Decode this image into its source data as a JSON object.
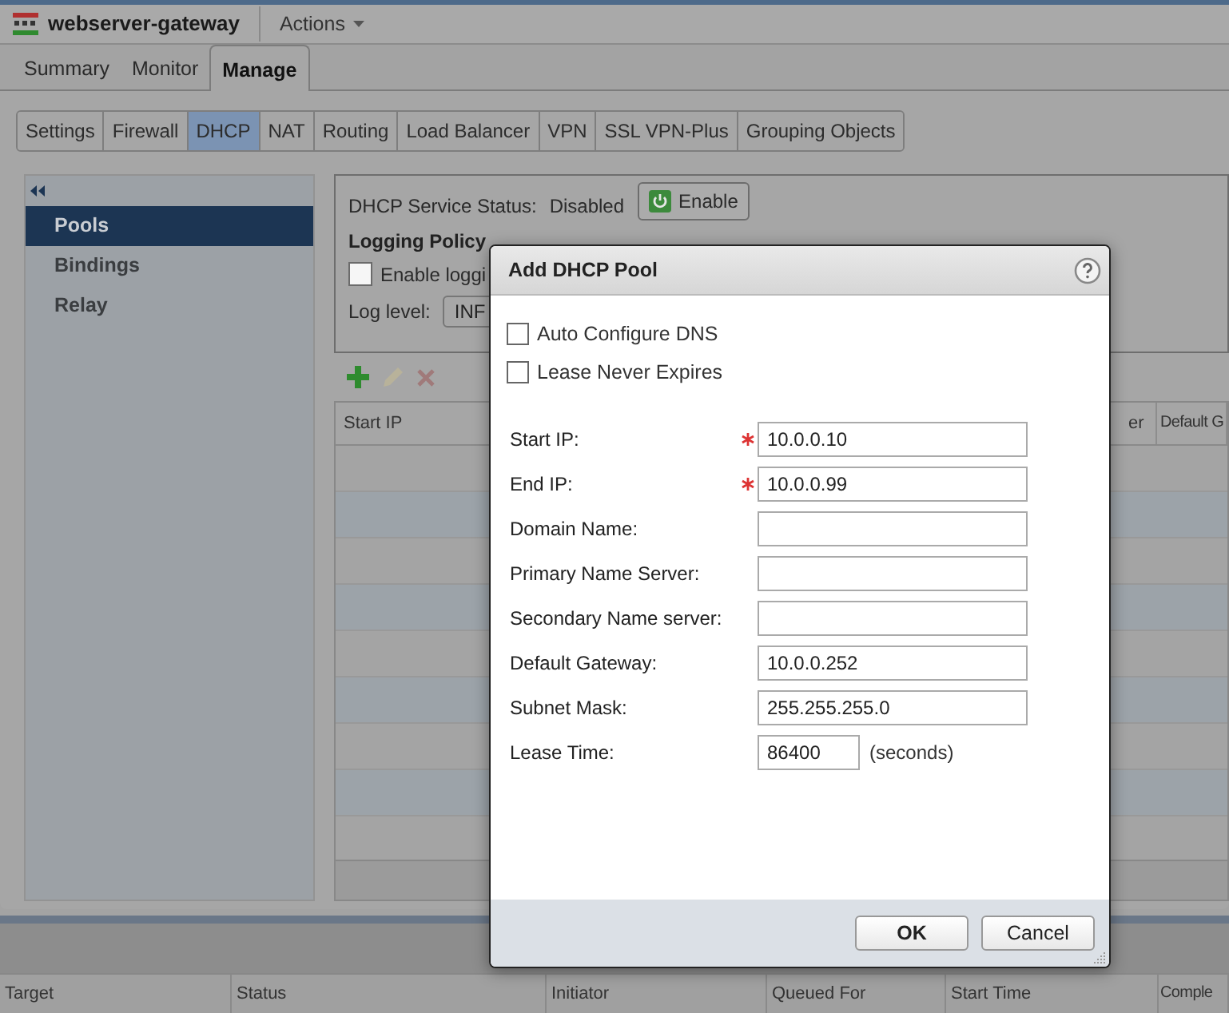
{
  "header": {
    "title": "webserver-gateway",
    "actions_menu": "Actions"
  },
  "tabs": [
    {
      "label": "Summary",
      "selected": false
    },
    {
      "label": "Monitor",
      "selected": false
    },
    {
      "label": "Manage",
      "selected": true
    }
  ],
  "subtabs": [
    {
      "label": "Settings",
      "selected": false
    },
    {
      "label": "Firewall",
      "selected": false
    },
    {
      "label": "DHCP",
      "selected": true
    },
    {
      "label": "NAT",
      "selected": false
    },
    {
      "label": "Routing",
      "selected": false
    },
    {
      "label": "Load Balancer",
      "selected": false
    },
    {
      "label": "VPN",
      "selected": false
    },
    {
      "label": "SSL VPN-Plus",
      "selected": false
    },
    {
      "label": "Grouping Objects",
      "selected": false
    }
  ],
  "sidebar": {
    "items": [
      {
        "label": "Pools",
        "selected": true
      },
      {
        "label": "Bindings",
        "selected": false
      },
      {
        "label": "Relay",
        "selected": false
      }
    ]
  },
  "service": {
    "label": "DHCP Service Status:",
    "value": "Disabled",
    "button": "Enable"
  },
  "logging": {
    "title": "Logging Policy",
    "checkbox": {
      "label": "Enable loggi",
      "checked": false
    },
    "log_level": {
      "label": "Log level:",
      "value": "INF"
    }
  },
  "pools_table": {
    "columns": [
      "Start IP",
      "er",
      "Default G"
    ]
  },
  "dialog": {
    "title": "Add DHCP Pool",
    "options": [
      {
        "label": "Auto Configure DNS",
        "checked": false
      },
      {
        "label": "Lease Never Expires",
        "checked": false
      }
    ],
    "fields": [
      {
        "label": "Start IP:",
        "value": "10.0.0.10",
        "required": true
      },
      {
        "label": "End IP:",
        "value": "10.0.0.99",
        "required": true
      },
      {
        "label": "Domain Name:",
        "required": false
      },
      {
        "label": "Primary Name Server:",
        "required": false
      },
      {
        "label": "Secondary Name server:",
        "required": false
      },
      {
        "label": "Default Gateway:",
        "value": "10.0.0.252",
        "required": false
      },
      {
        "label": "Subnet Mask:",
        "value": "255.255.255.0",
        "required": false
      },
      {
        "label": "Lease Time:",
        "value": "86400",
        "unit": "(seconds)",
        "required": false
      }
    ],
    "buttons": [
      "OK",
      "Cancel"
    ]
  },
  "tasks_table": {
    "columns": [
      "Target",
      "Status",
      "Initiator",
      "Queued For",
      "Start Time",
      "Comple"
    ]
  }
}
